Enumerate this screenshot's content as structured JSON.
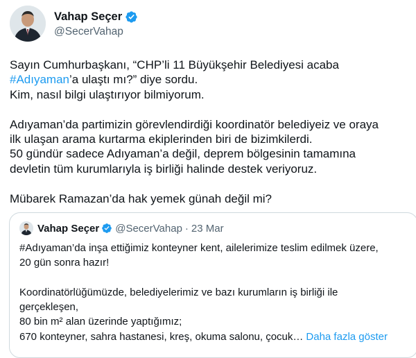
{
  "tweet": {
    "author": {
      "display_name": "Vahap Seçer",
      "handle": "@SecerVahap",
      "verified_icon": "verified-badge-icon",
      "accent_color": "#1d9bf0"
    },
    "body": {
      "line1": "Sayın Cumhurbaşkanı, “CHP’li 11 Büyükşehir Belediyesi acaba",
      "line2_hashtag": "#Adıyaman",
      "line2_rest": "’a ulaştı mı?” diye sordu.",
      "line3": "Kim, nasıl bilgi ulaştırıyor bilmiyorum.",
      "line4": "Adıyaman’da partimizin görevlendirdiği koordinatör belediyeiz ve oraya",
      "line5": "ilk ulaşan arama kurtarma ekiplerinden biri de bizimkilerdi.",
      "line6": "50 gündür sadece Adıyaman’a değil, deprem bölgesinin tamamına",
      "line7": "devletin tüm kurumlarıyla iş birliği halinde destek veriyoruz.",
      "line8": "Mübarek Ramazan’da hak yemek günah değil mi?"
    },
    "quoted": {
      "display_name": "Vahap Seçer",
      "handle": "@SecerVahap",
      "separator": "·",
      "date": "23 Mar",
      "line1": "#Adıyaman’da inşa ettiğimiz konteyner kent, ailelerimize teslim edilmek üzere,",
      "line2": "20 gün sonra hazır!",
      "line3": "Koordinatörlüğümüzde, belediyelerimiz ve bazı kurumların iş birliği ile",
      "line4": "gerçekleşen,",
      "line5": "80 bin m² alan üzerinde yaptığımız;",
      "line6": "670 konteyner, sahra hastanesi, kreş, okuma salonu, çocuk…",
      "show_more": "Daha fazla göster"
    }
  }
}
